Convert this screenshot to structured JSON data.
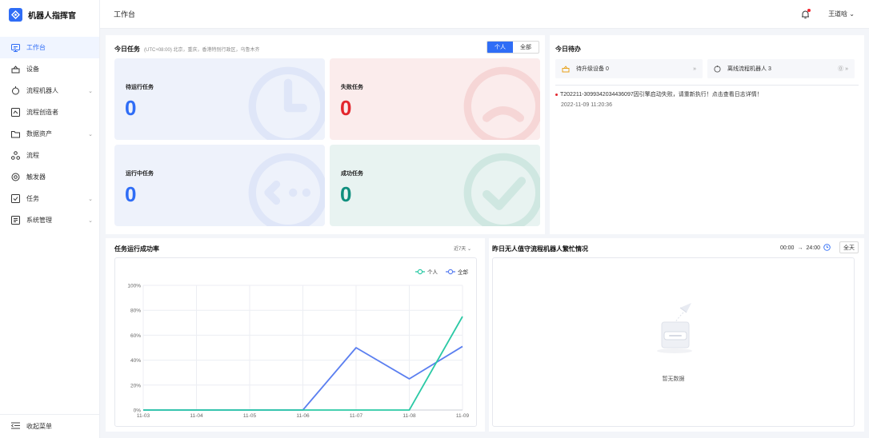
{
  "brand": {
    "title": "机器人指挥官"
  },
  "sidebar": {
    "items": [
      {
        "label": "工作台",
        "icon": "monitor-icon",
        "active": true,
        "arrow": ""
      },
      {
        "label": "设备",
        "icon": "device-icon",
        "active": false,
        "arrow": ""
      },
      {
        "label": "流程机器人",
        "icon": "robot-icon",
        "active": false,
        "arrow": "⌄"
      },
      {
        "label": "流程创造者",
        "icon": "designer-icon",
        "active": false,
        "arrow": ""
      },
      {
        "label": "数据资产",
        "icon": "folder-icon",
        "active": false,
        "arrow": "⌄"
      },
      {
        "label": "流程",
        "icon": "flow-icon",
        "active": false,
        "arrow": ""
      },
      {
        "label": "触发器",
        "icon": "trigger-icon",
        "active": false,
        "arrow": ""
      },
      {
        "label": "任务",
        "icon": "task-icon",
        "active": false,
        "arrow": "⌄"
      },
      {
        "label": "系统管理",
        "icon": "settings-icon",
        "active": false,
        "arrow": "⌄"
      }
    ],
    "collapse_label": "收起菜单"
  },
  "header": {
    "title": "工作台",
    "user": "王道晗 ⌄",
    "accent": "#2f6df6"
  },
  "tasks": {
    "title": "今日任务",
    "timezone": "(UTC+08:00) 北京，重庆，香港特别行政区，乌鲁木齐",
    "toggle": {
      "personal": "个人",
      "all": "全部",
      "selected": "个人"
    },
    "cards": [
      {
        "label": "待运行任务",
        "value": "0",
        "color": "#2f6df6"
      },
      {
        "label": "失败任务",
        "value": "0",
        "color": "#e3262d"
      },
      {
        "label": "运行中任务",
        "value": "0",
        "color": "#2f6df6"
      },
      {
        "label": "成功任务",
        "value": "0",
        "color": "#0f8f7e"
      }
    ]
  },
  "todo": {
    "title": "今日待办",
    "tabs": [
      {
        "label": "待升级设备 0",
        "icon": "device-icon",
        "more": "»"
      },
      {
        "label": "离线流程机器人 3",
        "icon": "robot-icon",
        "more": "⓪ »"
      }
    ],
    "message": "T202211-3099342034436097因引擎启动失败，请重新执行！点击查看日志详情！",
    "message_time": "2022-11-09 11:20:36"
  },
  "rate": {
    "title": "任务运行成功率",
    "range": "近7天 ⌄"
  },
  "busy": {
    "title": "昨日无人值守流程机器人繁忙情况",
    "start": "00:00",
    "arrow": "→",
    "end": "24:00",
    "all_day": "全天",
    "empty_text": "暂无数据"
  },
  "chart_data": {
    "type": "line",
    "x": [
      "11-03",
      "11-04",
      "11-05",
      "11-06",
      "11-07",
      "11-08",
      "11-09"
    ],
    "y_ticks": [
      "0%",
      "20%",
      "40%",
      "60%",
      "80%",
      "100%"
    ],
    "ylim": [
      0,
      100
    ],
    "grid": true,
    "legend_placement": "top-right",
    "series": [
      {
        "name": "个人",
        "color": "#2bc9a5",
        "values": [
          0,
          0,
          0,
          0,
          0,
          0,
          75
        ]
      },
      {
        "name": "全部",
        "color": "#5b7ff0",
        "values": [
          0,
          0,
          0,
          0,
          50,
          25,
          51
        ]
      }
    ]
  }
}
